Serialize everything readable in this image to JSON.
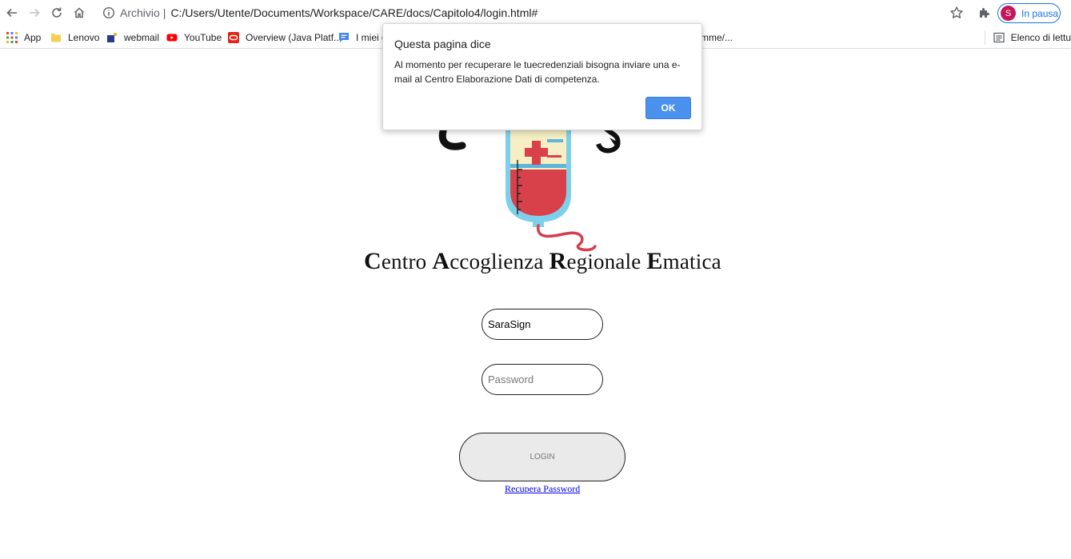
{
  "browser": {
    "url_label": "Archivio",
    "url_path": "C:/Users/Utente/Documents/Workspace/CARE/docs/Capitolo4/login.html#",
    "profile_initial": "S",
    "profile_status": "In pausa",
    "accent_color": "#1a73e8"
  },
  "bookmarks": [
    {
      "label": "App",
      "icon": "apps-grid-icon"
    },
    {
      "label": "Lenovo",
      "icon": "folder-icon"
    },
    {
      "label": "webmail",
      "icon": "webmail-icon"
    },
    {
      "label": "YouTube",
      "icon": "youtube-icon"
    },
    {
      "label": "Overview (Java Platf...",
      "icon": "oracle-icon"
    },
    {
      "label": "I miei g",
      "icon": "chat-icon"
    },
    {
      "label": "mme/...",
      "icon": ""
    }
  ],
  "reading_list": "Elenco di lettu",
  "page": {
    "title_parts": [
      {
        "initial": "C",
        "rest": "entro "
      },
      {
        "initial": "A",
        "rest": "ccoglienza "
      },
      {
        "initial": "R",
        "rest": "egionale "
      },
      {
        "initial": "E",
        "rest": "matica"
      }
    ],
    "username_value": "SaraSign",
    "password_placeholder": "Password",
    "login_label": "LOGIN",
    "recover_label": "Recupera Password"
  },
  "dialog": {
    "title": "Questa pagina dice",
    "message": "Al momento per recuperare le tuecredenziali bisogna inviare una e-mail al Centro Elaborazione Dati di competenza.",
    "ok_label": "OK",
    "ok_color": "#4a90ed"
  }
}
